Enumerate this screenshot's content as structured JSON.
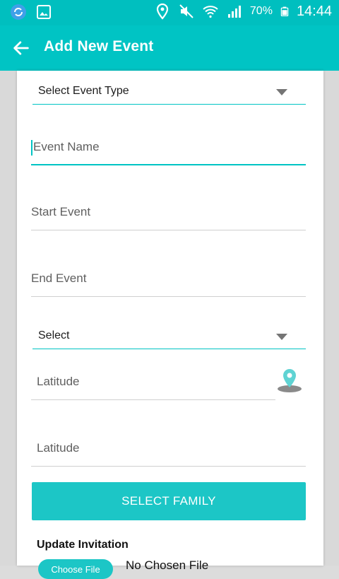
{
  "status_bar": {
    "battery": "70%",
    "time": "14:44",
    "left_icons": [
      "sync-app-icon",
      "gallery-icon"
    ],
    "right_icons": [
      "location-icon",
      "mute-icon",
      "wifi-icon",
      "signal-icon",
      "battery-icon"
    ]
  },
  "app_bar": {
    "title": "Add New Event",
    "back_icon": "arrow-left-icon",
    "color": "#00c4c4"
  },
  "form": {
    "event_type_dropdown": "Select Event Type",
    "event_name_hint": "Event Name",
    "start_event_hint": "Start Event",
    "end_event_hint": "End Event",
    "select_dropdown": "Select",
    "latitude_hint_1": "Latitude",
    "latitude_hint_2": "Latitude",
    "location_pin_icon": "map-pin-icon",
    "select_family_button": "SELECT FAMILY"
  },
  "update_invitation": {
    "title": "Update Invitation",
    "choose_file_button": "Choose File",
    "no_file_text": "No Chosen File"
  }
}
